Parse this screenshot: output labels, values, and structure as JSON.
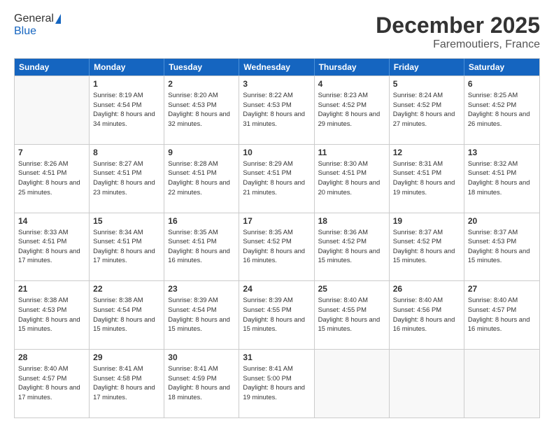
{
  "header": {
    "logo_general": "General",
    "logo_blue": "Blue",
    "month_year": "December 2025",
    "location": "Faremoutiers, France"
  },
  "days_of_week": [
    "Sunday",
    "Monday",
    "Tuesday",
    "Wednesday",
    "Thursday",
    "Friday",
    "Saturday"
  ],
  "weeks": [
    [
      {
        "day": "",
        "sunrise": "",
        "sunset": "",
        "daylight": ""
      },
      {
        "day": "1",
        "sunrise": "Sunrise: 8:19 AM",
        "sunset": "Sunset: 4:54 PM",
        "daylight": "Daylight: 8 hours and 34 minutes."
      },
      {
        "day": "2",
        "sunrise": "Sunrise: 8:20 AM",
        "sunset": "Sunset: 4:53 PM",
        "daylight": "Daylight: 8 hours and 32 minutes."
      },
      {
        "day": "3",
        "sunrise": "Sunrise: 8:22 AM",
        "sunset": "Sunset: 4:53 PM",
        "daylight": "Daylight: 8 hours and 31 minutes."
      },
      {
        "day": "4",
        "sunrise": "Sunrise: 8:23 AM",
        "sunset": "Sunset: 4:52 PM",
        "daylight": "Daylight: 8 hours and 29 minutes."
      },
      {
        "day": "5",
        "sunrise": "Sunrise: 8:24 AM",
        "sunset": "Sunset: 4:52 PM",
        "daylight": "Daylight: 8 hours and 27 minutes."
      },
      {
        "day": "6",
        "sunrise": "Sunrise: 8:25 AM",
        "sunset": "Sunset: 4:52 PM",
        "daylight": "Daylight: 8 hours and 26 minutes."
      }
    ],
    [
      {
        "day": "7",
        "sunrise": "Sunrise: 8:26 AM",
        "sunset": "Sunset: 4:51 PM",
        "daylight": "Daylight: 8 hours and 25 minutes."
      },
      {
        "day": "8",
        "sunrise": "Sunrise: 8:27 AM",
        "sunset": "Sunset: 4:51 PM",
        "daylight": "Daylight: 8 hours and 23 minutes."
      },
      {
        "day": "9",
        "sunrise": "Sunrise: 8:28 AM",
        "sunset": "Sunset: 4:51 PM",
        "daylight": "Daylight: 8 hours and 22 minutes."
      },
      {
        "day": "10",
        "sunrise": "Sunrise: 8:29 AM",
        "sunset": "Sunset: 4:51 PM",
        "daylight": "Daylight: 8 hours and 21 minutes."
      },
      {
        "day": "11",
        "sunrise": "Sunrise: 8:30 AM",
        "sunset": "Sunset: 4:51 PM",
        "daylight": "Daylight: 8 hours and 20 minutes."
      },
      {
        "day": "12",
        "sunrise": "Sunrise: 8:31 AM",
        "sunset": "Sunset: 4:51 PM",
        "daylight": "Daylight: 8 hours and 19 minutes."
      },
      {
        "day": "13",
        "sunrise": "Sunrise: 8:32 AM",
        "sunset": "Sunset: 4:51 PM",
        "daylight": "Daylight: 8 hours and 18 minutes."
      }
    ],
    [
      {
        "day": "14",
        "sunrise": "Sunrise: 8:33 AM",
        "sunset": "Sunset: 4:51 PM",
        "daylight": "Daylight: 8 hours and 17 minutes."
      },
      {
        "day": "15",
        "sunrise": "Sunrise: 8:34 AM",
        "sunset": "Sunset: 4:51 PM",
        "daylight": "Daylight: 8 hours and 17 minutes."
      },
      {
        "day": "16",
        "sunrise": "Sunrise: 8:35 AM",
        "sunset": "Sunset: 4:51 PM",
        "daylight": "Daylight: 8 hours and 16 minutes."
      },
      {
        "day": "17",
        "sunrise": "Sunrise: 8:35 AM",
        "sunset": "Sunset: 4:52 PM",
        "daylight": "Daylight: 8 hours and 16 minutes."
      },
      {
        "day": "18",
        "sunrise": "Sunrise: 8:36 AM",
        "sunset": "Sunset: 4:52 PM",
        "daylight": "Daylight: 8 hours and 15 minutes."
      },
      {
        "day": "19",
        "sunrise": "Sunrise: 8:37 AM",
        "sunset": "Sunset: 4:52 PM",
        "daylight": "Daylight: 8 hours and 15 minutes."
      },
      {
        "day": "20",
        "sunrise": "Sunrise: 8:37 AM",
        "sunset": "Sunset: 4:53 PM",
        "daylight": "Daylight: 8 hours and 15 minutes."
      }
    ],
    [
      {
        "day": "21",
        "sunrise": "Sunrise: 8:38 AM",
        "sunset": "Sunset: 4:53 PM",
        "daylight": "Daylight: 8 hours and 15 minutes."
      },
      {
        "day": "22",
        "sunrise": "Sunrise: 8:38 AM",
        "sunset": "Sunset: 4:54 PM",
        "daylight": "Daylight: 8 hours and 15 minutes."
      },
      {
        "day": "23",
        "sunrise": "Sunrise: 8:39 AM",
        "sunset": "Sunset: 4:54 PM",
        "daylight": "Daylight: 8 hours and 15 minutes."
      },
      {
        "day": "24",
        "sunrise": "Sunrise: 8:39 AM",
        "sunset": "Sunset: 4:55 PM",
        "daylight": "Daylight: 8 hours and 15 minutes."
      },
      {
        "day": "25",
        "sunrise": "Sunrise: 8:40 AM",
        "sunset": "Sunset: 4:55 PM",
        "daylight": "Daylight: 8 hours and 15 minutes."
      },
      {
        "day": "26",
        "sunrise": "Sunrise: 8:40 AM",
        "sunset": "Sunset: 4:56 PM",
        "daylight": "Daylight: 8 hours and 16 minutes."
      },
      {
        "day": "27",
        "sunrise": "Sunrise: 8:40 AM",
        "sunset": "Sunset: 4:57 PM",
        "daylight": "Daylight: 8 hours and 16 minutes."
      }
    ],
    [
      {
        "day": "28",
        "sunrise": "Sunrise: 8:40 AM",
        "sunset": "Sunset: 4:57 PM",
        "daylight": "Daylight: 8 hours and 17 minutes."
      },
      {
        "day": "29",
        "sunrise": "Sunrise: 8:41 AM",
        "sunset": "Sunset: 4:58 PM",
        "daylight": "Daylight: 8 hours and 17 minutes."
      },
      {
        "day": "30",
        "sunrise": "Sunrise: 8:41 AM",
        "sunset": "Sunset: 4:59 PM",
        "daylight": "Daylight: 8 hours and 18 minutes."
      },
      {
        "day": "31",
        "sunrise": "Sunrise: 8:41 AM",
        "sunset": "Sunset: 5:00 PM",
        "daylight": "Daylight: 8 hours and 19 minutes."
      },
      {
        "day": "",
        "sunrise": "",
        "sunset": "",
        "daylight": ""
      },
      {
        "day": "",
        "sunrise": "",
        "sunset": "",
        "daylight": ""
      },
      {
        "day": "",
        "sunrise": "",
        "sunset": "",
        "daylight": ""
      }
    ]
  ]
}
